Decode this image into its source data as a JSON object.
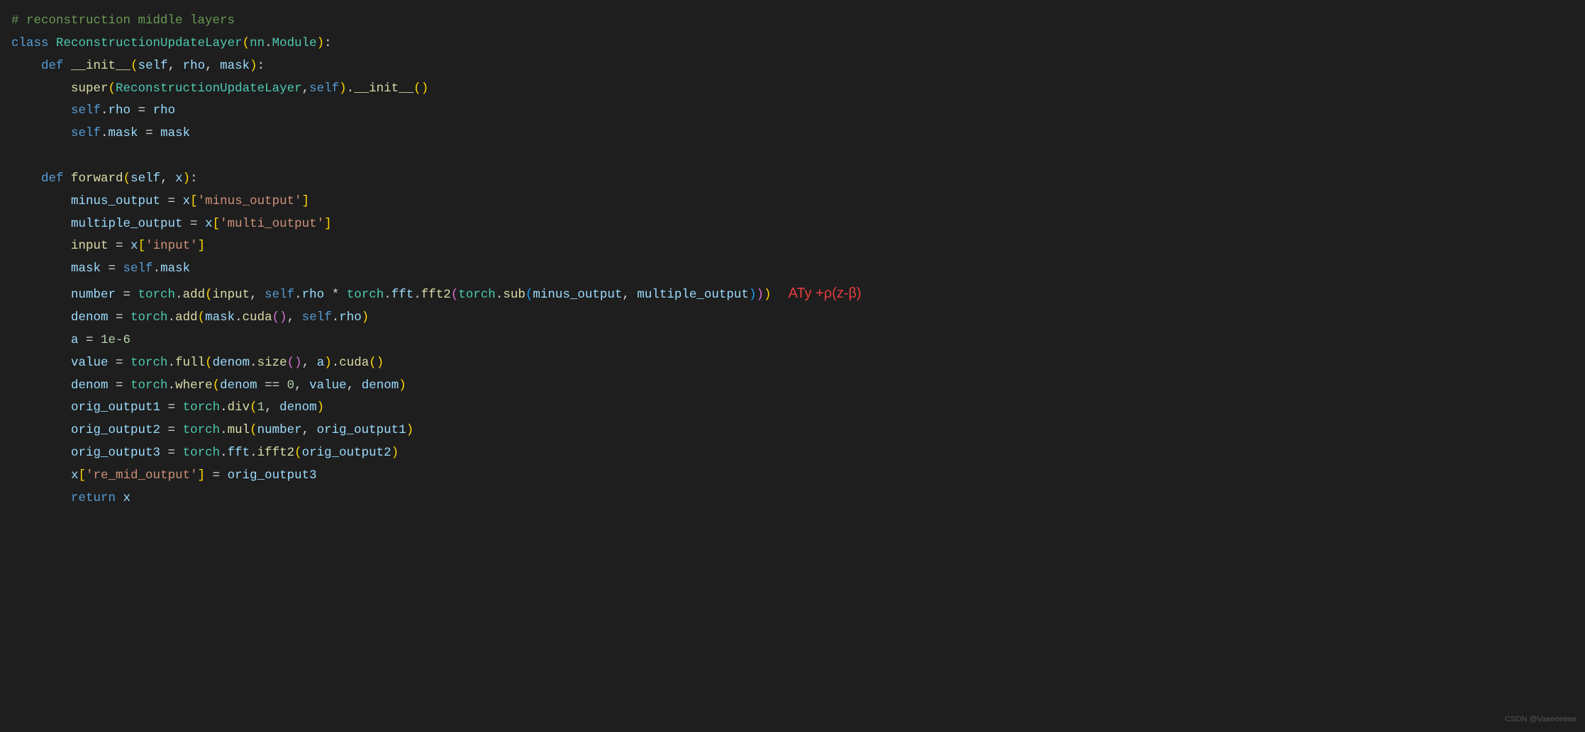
{
  "code": {
    "line1": {
      "comment": "# reconstruction middle layers"
    },
    "line2": {
      "keyword_class": "class",
      "class_name": "ReconstructionUpdateLayer",
      "paren_open": "(",
      "module": "nn",
      "dot": ".",
      "parent": "Module",
      "paren_close": ")",
      "colon": ":"
    },
    "line3": {
      "indent": "    ",
      "keyword_def": "def",
      "func": "__init__",
      "paren_open": "(",
      "self": "self",
      "comma1": ", ",
      "p1": "rho",
      "comma2": ", ",
      "p2": "mask",
      "paren_close": ")",
      "colon": ":"
    },
    "line4": {
      "indent": "        ",
      "super": "super",
      "po": "(",
      "cn": "ReconstructionUpdateLayer",
      "comma": ",",
      "self": "self",
      "pc": ")",
      "dot": ".",
      "init": "__init__",
      "po2": "(",
      "pc2": ")"
    },
    "line5": {
      "indent": "        ",
      "self": "self",
      "dot": ".",
      "attr": "rho",
      "eq": " = ",
      "val": "rho"
    },
    "line6": {
      "indent": "        ",
      "self": "self",
      "dot": ".",
      "attr": "mask",
      "eq": " = ",
      "val": "mask"
    },
    "line8": {
      "indent": "    ",
      "keyword_def": "def",
      "func": "forward",
      "paren_open": "(",
      "self": "self",
      "comma": ", ",
      "p1": "x",
      "paren_close": ")",
      "colon": ":"
    },
    "line9": {
      "indent": "        ",
      "var": "minus_output",
      "eq": " = ",
      "x": "x",
      "bo": "[",
      "key": "'minus_output'",
      "bc": "]"
    },
    "line10": {
      "indent": "        ",
      "var": "multiple_output",
      "eq": " = ",
      "x": "x",
      "bo": "[",
      "key": "'multi_output'",
      "bc": "]"
    },
    "line11": {
      "indent": "        ",
      "var": "input",
      "eq": " = ",
      "x": "x",
      "bo": "[",
      "key": "'input'",
      "bc": "]"
    },
    "line12": {
      "indent": "        ",
      "var": "mask",
      "eq": " = ",
      "self": "self",
      "dot": ".",
      "attr": "mask"
    },
    "line13": {
      "indent": "        ",
      "var": "number",
      "eq": " = ",
      "torch1": "torch",
      "dot1": ".",
      "add": "add",
      "po1": "(",
      "input": "input",
      "comma1": ", ",
      "self": "self",
      "dot2": ".",
      "rho": "rho",
      "mul": " * ",
      "torch2": "torch",
      "dot3": ".",
      "fft1": "fft",
      "dot4": ".",
      "fft2": "fft2",
      "po2": "(",
      "torch3": "torch",
      "dot5": ".",
      "sub": "sub",
      "po3": "(",
      "mo": "minus_output",
      "comma2": ", ",
      "muo": "multiple_output",
      "pc3": ")",
      "pc2": ")",
      "pc1": ")"
    },
    "line14": {
      "indent": "        ",
      "var": "denom",
      "eq": " = ",
      "torch": "torch",
      "dot": ".",
      "add": "add",
      "po": "(",
      "mask": "mask",
      "dot2": ".",
      "cuda": "cuda",
      "po2": "(",
      "pc2": ")",
      "comma": ", ",
      "self": "self",
      "dot3": ".",
      "rho": "rho",
      "pc": ")"
    },
    "line15": {
      "indent": "        ",
      "var": "a",
      "eq": " = ",
      "num": "1e-6"
    },
    "line16": {
      "indent": "        ",
      "var": "value",
      "eq": " = ",
      "torch": "torch",
      "dot": ".",
      "full": "full",
      "po": "(",
      "denom": "denom",
      "dot2": ".",
      "size": "size",
      "po2": "(",
      "pc2": ")",
      "comma": ", ",
      "a": "a",
      "pc": ")",
      "dot3": ".",
      "cuda": "cuda",
      "po3": "(",
      "pc3": ")"
    },
    "line17": {
      "indent": "        ",
      "var": "denom",
      "eq": " = ",
      "torch": "torch",
      "dot": ".",
      "where": "where",
      "po": "(",
      "denom": "denom",
      "eqeq": " == ",
      "zero": "0",
      "comma1": ", ",
      "value": "value",
      "comma2": ", ",
      "denom2": "denom",
      "pc": ")"
    },
    "line18": {
      "indent": "        ",
      "var": "orig_output1",
      "eq": " = ",
      "torch": "torch",
      "dot": ".",
      "div": "div",
      "po": "(",
      "one": "1",
      "comma": ", ",
      "denom": "denom",
      "pc": ")"
    },
    "line19": {
      "indent": "        ",
      "var": "orig_output2",
      "eq": " = ",
      "torch": "torch",
      "dot": ".",
      "mul": "mul",
      "po": "(",
      "number": "number",
      "comma": ", ",
      "oo1": "orig_output1",
      "pc": ")"
    },
    "line20": {
      "indent": "        ",
      "var": "orig_output3",
      "eq": " = ",
      "torch": "torch",
      "dot": ".",
      "fft": "fft",
      "dot2": ".",
      "ifft2": "ifft2",
      "po": "(",
      "oo2": "orig_output2",
      "pc": ")"
    },
    "line21": {
      "indent": "        ",
      "x": "x",
      "bo": "[",
      "key": "'re_mid_output'",
      "bc": "]",
      "eq": " = ",
      "oo3": "orig_output3"
    },
    "line22": {
      "indent": "        ",
      "return": "return",
      "sp": " ",
      "x": "x"
    }
  },
  "annotation": "ATy +ρ(z-β)",
  "watermark": "CSDN @Vaeeeeeee"
}
